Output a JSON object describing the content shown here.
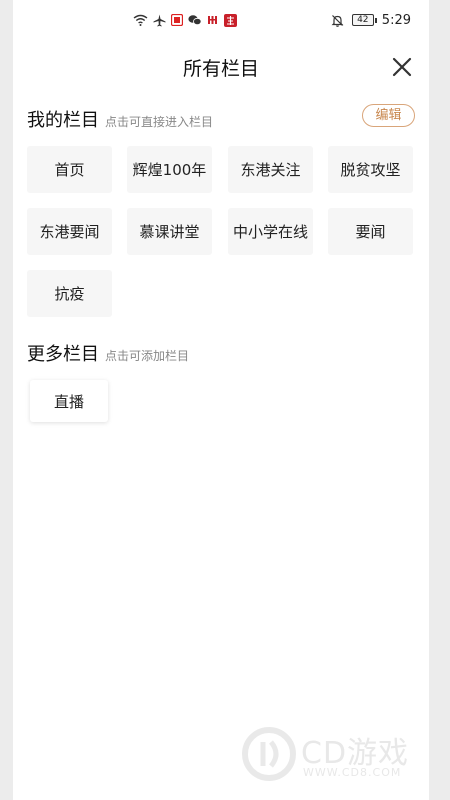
{
  "status_bar": {
    "time": "5:29",
    "battery": "42",
    "icons_left": [
      "wifi-icon",
      "airplane-icon",
      "red-square-app-icon",
      "wechat-icon",
      "red-app-icon",
      "red-app-icon-2"
    ],
    "icons_right": [
      "mute-bell-icon",
      "battery-icon"
    ]
  },
  "header": {
    "title": "所有栏目",
    "close_icon": "close-icon"
  },
  "my_section": {
    "title": "我的栏目",
    "hint": "点击可直接进入栏目",
    "edit_label": "编辑",
    "items": [
      "首页",
      "辉煌100年",
      "东港关注",
      "脱贫攻坚",
      "东港要闻",
      "慕课讲堂",
      "中小学在线",
      "要闻",
      "抗疫"
    ]
  },
  "more_section": {
    "title": "更多栏目",
    "hint": "点击可添加栏目",
    "items": [
      "直播"
    ]
  },
  "watermark": {
    "text": "CD游戏",
    "url": "WWW.CD8.COM"
  },
  "colors": {
    "accent": "#c8874e",
    "chip_bg": "#f6f6f6",
    "background": "#ffffff"
  }
}
